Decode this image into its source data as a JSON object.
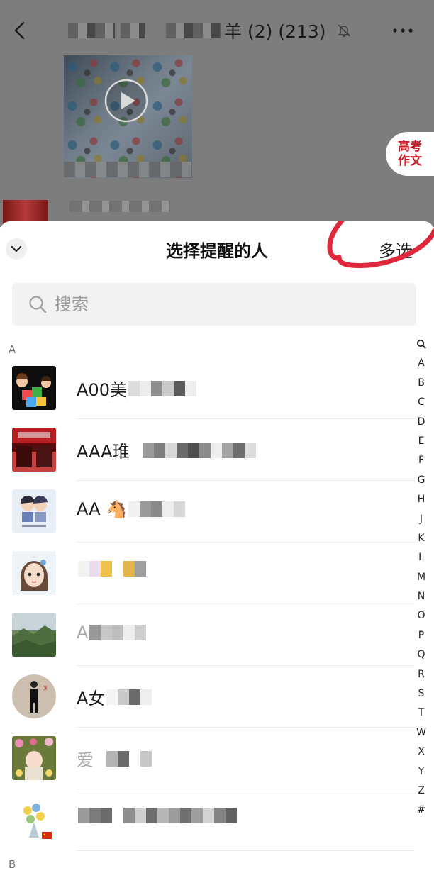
{
  "chat": {
    "title_suffix": "羊 (2) (213)",
    "icons": {
      "back": "back-arrow-icon",
      "mute": "bell-off-icon",
      "more": "more-dots-icon",
      "play": "play-icon"
    }
  },
  "floating_badge": {
    "line1": "高考",
    "line2": "作文"
  },
  "sheet": {
    "title": "选择提醒的人",
    "multi_select_label": "多选",
    "search_placeholder": "搜索",
    "section_letter": "A",
    "next_section_letter": "B",
    "annotation_color": "#e0283c"
  },
  "contacts": [
    {
      "name": "A00美",
      "mosaic": [
        "#dcdcdc",
        "#ececec",
        "#8d8d8d",
        "#c9c9c9",
        "#5a5a5a",
        "#eeeeee"
      ]
    },
    {
      "name": "AAA琟",
      "mosaic": [
        "#ffffff",
        "#9a9a9a",
        "#7e7e7e",
        "#d8d8d8",
        "#6a6a6a",
        "#4f4f4f",
        "#8b8b8b",
        "#eeeeee",
        "#a3a3a3",
        "#6e6e6e",
        "#dcdcdc"
      ]
    },
    {
      "name": "AA 🐴",
      "mosaic": [
        "#f0f0f0",
        "#9b9b9b",
        "#8a8a8a",
        "#eeeeee",
        "#d6d6d6"
      ]
    },
    {
      "name": "",
      "mosaic": [
        "#f2f2f2",
        "#eadcee",
        "#f0c14a",
        "#ffffff",
        "#e5b44a",
        "#9f9f9f"
      ]
    },
    {
      "name": "A",
      "mosaic": [
        "#999999",
        "#c7c7c7",
        "#bdbdbd",
        "#eeeeee",
        "#cfcfcf"
      ]
    },
    {
      "name": "A女",
      "mosaic": [
        "#f4f4f4",
        "#cacaca",
        "#6b6b6b",
        "#eeeeee"
      ]
    },
    {
      "name": "爱",
      "mosaic": [
        "#ffffff",
        "#b5b5b5",
        "#6a6a6a",
        "#ffffff",
        "#c8c8c8"
      ]
    },
    {
      "name": "",
      "mosaic": [
        "#9b9b9b",
        "#7c7c7c",
        "#6b6b6b",
        "#ffffff",
        "#8e8e8e",
        "#cfcfcf",
        "#6e6e6e",
        "#b7b7b7",
        "#9d9d9d",
        "#707070",
        "#9e9e9e",
        "#d3d3d3",
        "#848484",
        "#626262"
      ]
    }
  ],
  "avatars": [
    "kids-blocks-avatar",
    "storefront-avatar",
    "cartoon-couple-avatar",
    "girl-portrait-avatar",
    "mountain-landscape-avatar",
    "person-walking-avatar",
    "baby-flowers-avatar",
    "flower-bouquet-avatar"
  ],
  "index_letters": [
    "A",
    "B",
    "C",
    "D",
    "E",
    "F",
    "G",
    "H",
    "J",
    "K",
    "L",
    "M",
    "N",
    "O",
    "P",
    "Q",
    "R",
    "S",
    "T",
    "W",
    "X",
    "Y",
    "Z",
    "#"
  ]
}
